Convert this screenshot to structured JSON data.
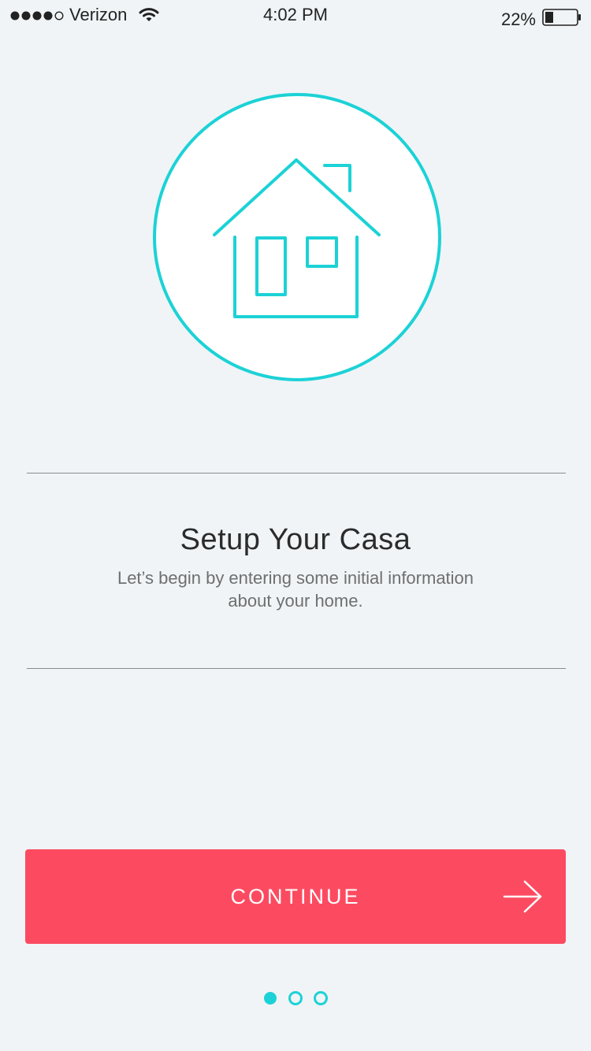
{
  "status_bar": {
    "carrier": "Verizon",
    "time": "4:02 PM",
    "battery_percent": "22%",
    "signal_icon": "signal-dots-icon",
    "wifi_icon": "wifi-icon",
    "battery_icon": "battery-icon"
  },
  "hero": {
    "icon": "house-icon",
    "accent_color": "#1cd2d6"
  },
  "content": {
    "title": "Setup Your Casa",
    "subtitle": "Let’s begin by entering some initial information about your home."
  },
  "actions": {
    "continue_label": "CONTINUE",
    "continue_icon": "arrow-right-icon",
    "button_color": "#fc4b61"
  },
  "pagination": {
    "total_pages": 3,
    "current_page": 1
  }
}
